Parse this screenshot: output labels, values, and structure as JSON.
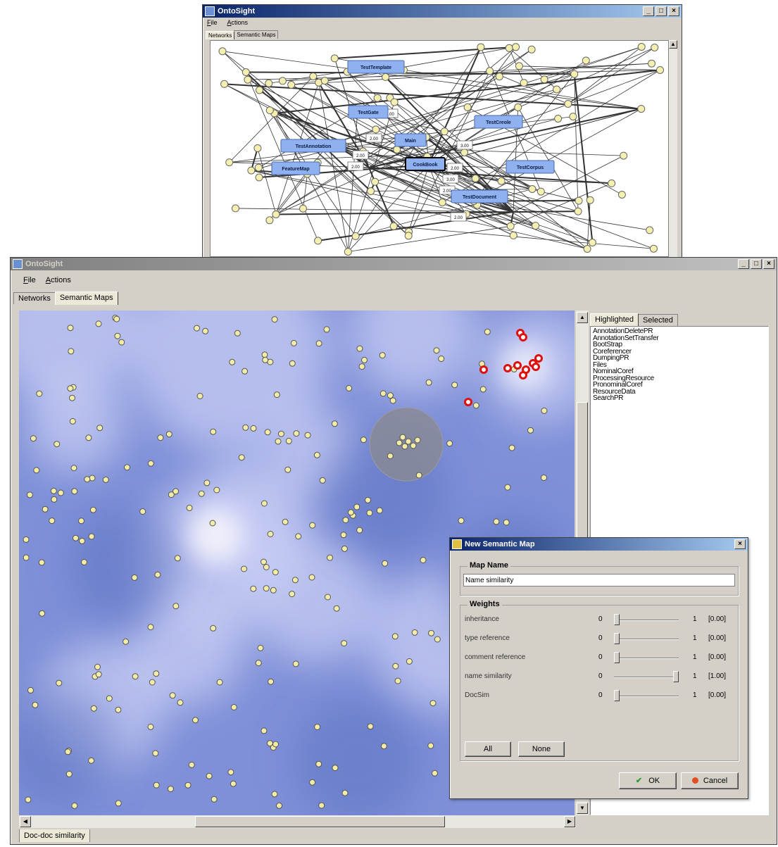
{
  "back_window": {
    "title": "OntoSight",
    "menu": [
      "File",
      "Actions"
    ],
    "tabs": [
      "Networks",
      "Semantic Maps"
    ],
    "class_nodes": [
      "TestTemplate",
      "TestGate",
      "TestCreole",
      "Main",
      "TestAnnotation",
      "FeatureMap",
      "CookBook",
      "TestCorpus",
      "TestDocument"
    ],
    "edge_labels": [
      "2.00",
      "2.00",
      "3.00",
      "2.00",
      "2.00",
      "2.00",
      "2.00",
      "3.00",
      "2.00"
    ]
  },
  "front_window": {
    "title": "OntoSight",
    "menu": [
      "File",
      "Actions"
    ],
    "tabs": [
      "Networks",
      "Semantic Maps"
    ],
    "bottom_tab": "Doc-doc similarity",
    "side_tabs": [
      "Highlighted",
      "Selected"
    ],
    "highlighted_items": [
      "AnnotationDeletePR",
      "AnnotationSetTransfer",
      "BootStrap",
      "Coreferencer",
      "DumpingPR",
      "Files",
      "NominalCoref",
      "ProcessingResource",
      "PronominalCoref",
      "ResourceData",
      "SearchPR"
    ]
  },
  "dialog": {
    "title": "New Semantic Map",
    "map_name_label": "Map Name",
    "map_name_value": "Name similarity",
    "weights_label": "Weights",
    "weights": [
      {
        "label": "inheritance",
        "min": "0",
        "max": "1",
        "value": "[0.00]",
        "level": 0
      },
      {
        "label": "type reference",
        "min": "0",
        "max": "1",
        "value": "[0.00]",
        "level": 0
      },
      {
        "label": "comment reference",
        "min": "0",
        "max": "1",
        "value": "[0.00]",
        "level": 0
      },
      {
        "label": "name similarity",
        "min": "0",
        "max": "1",
        "value": "[1.00]",
        "level": 1
      },
      {
        "label": "DocSim",
        "min": "0",
        "max": "1",
        "value": "[0.00]",
        "level": 0
      }
    ],
    "all_button": "All",
    "none_button": "None",
    "ok_button": "OK",
    "cancel_button": "Cancel"
  },
  "colors": {
    "map_background": "#7f90d8",
    "node_fill": "#f2eca8",
    "highlight_node": "#e01010",
    "class_node": "#8fb1f0"
  }
}
